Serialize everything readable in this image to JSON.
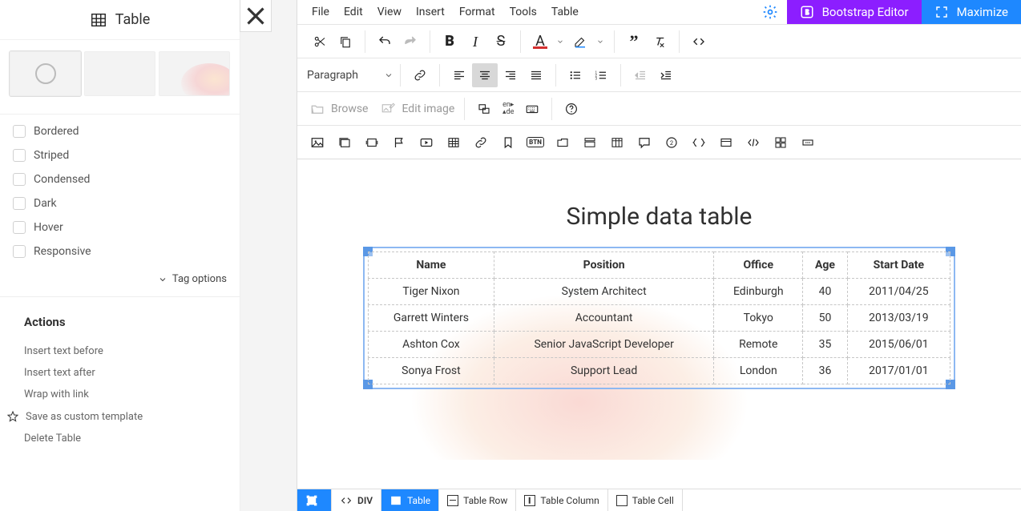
{
  "sidebar": {
    "title": "Table",
    "checks": [
      {
        "label": "Bordered"
      },
      {
        "label": "Striped"
      },
      {
        "label": "Condensed"
      },
      {
        "label": "Dark"
      },
      {
        "label": "Hover"
      },
      {
        "label": "Responsive"
      }
    ],
    "tag_options": "Tag options",
    "actions_title": "Actions",
    "actions": [
      {
        "label": "Insert text before"
      },
      {
        "label": "Insert text after"
      },
      {
        "label": "Wrap with link"
      },
      {
        "label": "Save as custom template",
        "icon": "star"
      },
      {
        "label": "Delete Table"
      }
    ]
  },
  "menubar": {
    "items": [
      "File",
      "Edit",
      "View",
      "Insert",
      "Format",
      "Tools",
      "Table"
    ],
    "bootstrap": "Bootstrap Editor",
    "maximize": "Maximize"
  },
  "toolbar": {
    "format_label": "Paragraph",
    "browse": "Browse",
    "edit_image": "Edit image",
    "lang_top": "en",
    "lang_bottom": "de",
    "btn_label": "BTN"
  },
  "document": {
    "title": "Simple data table",
    "headers": [
      "Name",
      "Position",
      "Office",
      "Age",
      "Start Date"
    ],
    "rows": [
      [
        "Tiger Nixon",
        "System Architect",
        "Edinburgh",
        "40",
        "2011/04/25"
      ],
      [
        "Garrett Winters",
        "Accountant",
        "Tokyo",
        "50",
        "2013/03/19"
      ],
      [
        "Ashton Cox",
        "Senior JavaScript Developer",
        "Remote",
        "35",
        "2015/06/01"
      ],
      [
        "Sonya Frost",
        "Support Lead",
        "London",
        "36",
        "2017/01/01"
      ]
    ]
  },
  "breadcrumb": {
    "items": [
      {
        "label": "",
        "icon": "bounds",
        "active": true
      },
      {
        "label": "DIV",
        "icon": "code"
      },
      {
        "label": "Table",
        "icon": "table",
        "active": true
      },
      {
        "label": "Table Row",
        "icon": "row"
      },
      {
        "label": "Table Column",
        "icon": "col"
      },
      {
        "label": "Table Cell",
        "icon": "cell"
      }
    ]
  }
}
